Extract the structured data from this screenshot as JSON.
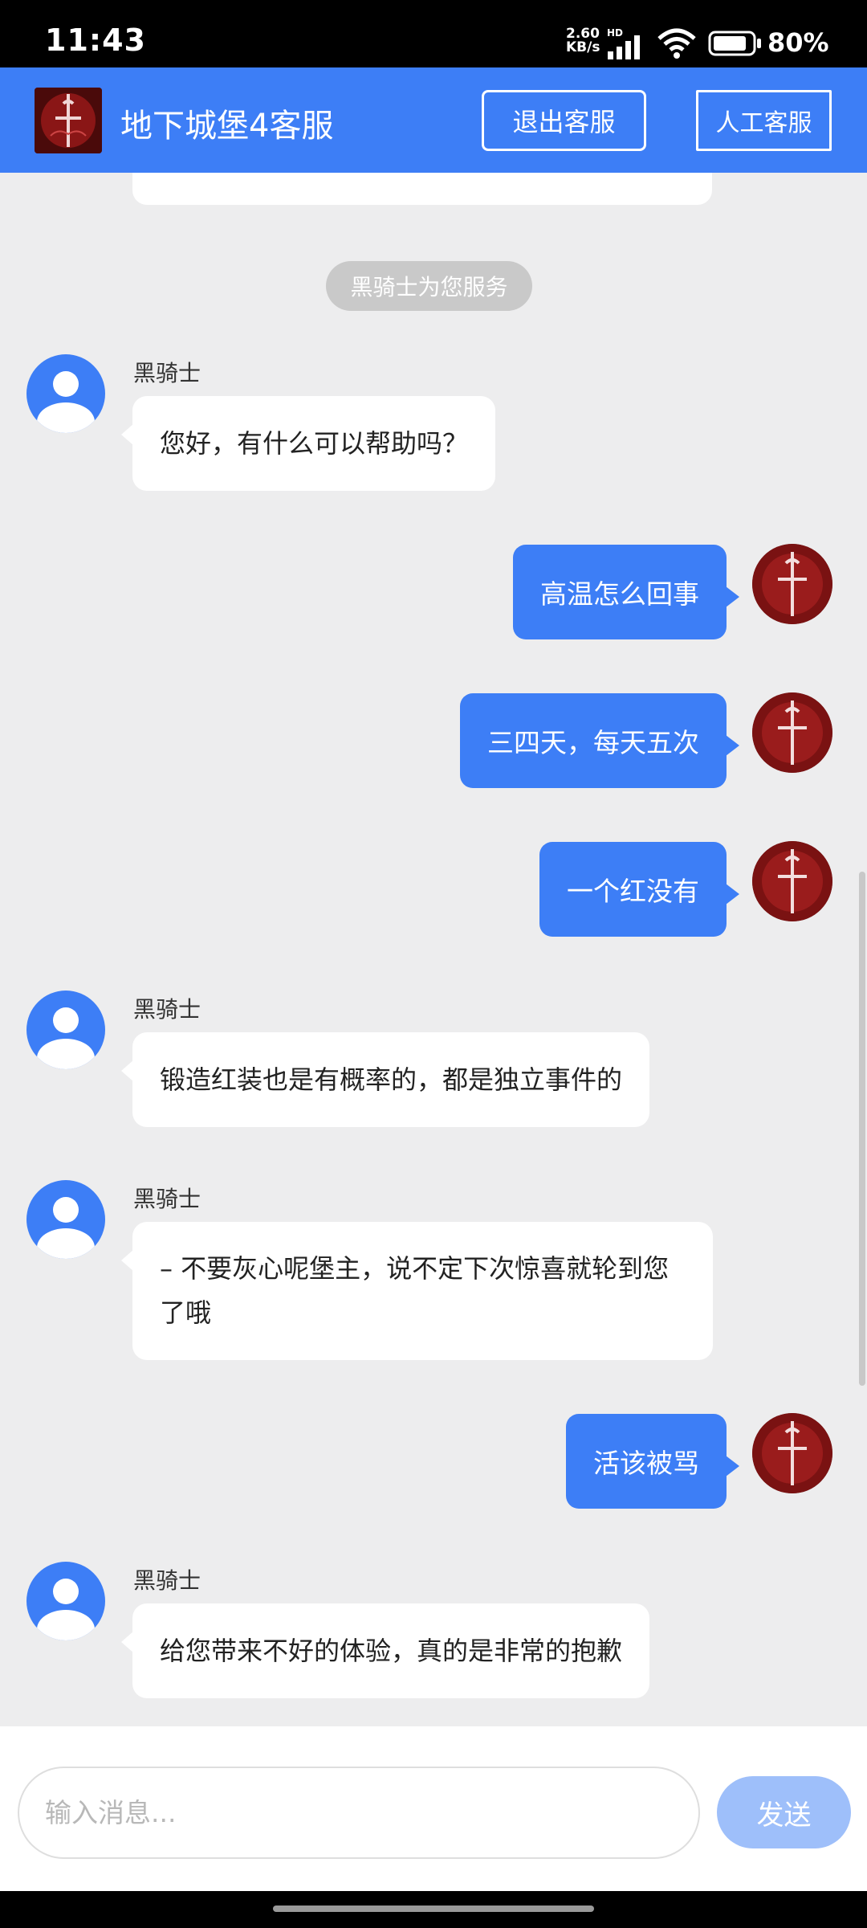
{
  "status_bar": {
    "time": "11:43",
    "net_speed_value": "2.60",
    "net_speed_unit": "KB/s",
    "hd": "HD",
    "battery": "80%",
    "icons": [
      "signal-icon",
      "wifi-icon",
      "battery-icon"
    ]
  },
  "header": {
    "title": "地下城堡4客服",
    "exit_label": "退出客服",
    "human_label": "人工客服",
    "bg_color": "#3d7ef6"
  },
  "system_notice": "黑骑士为您服务",
  "messages": [
    {
      "from": "agent",
      "sender": "黑骑士",
      "text": "您好，有什么可以帮助吗？"
    },
    {
      "from": "me",
      "text": "高温怎么回事"
    },
    {
      "from": "me",
      "text": "三四天，每天五次"
    },
    {
      "from": "me",
      "text": "一个红没有"
    },
    {
      "from": "agent",
      "sender": "黑骑士",
      "text": "锻造红装也是有概率的，都是独立事件的"
    },
    {
      "from": "agent",
      "sender": "黑骑士",
      "text": "– 不要灰心呢堡主，说不定下次惊喜就轮到您了哦"
    },
    {
      "from": "me",
      "text": "活该被骂"
    },
    {
      "from": "agent",
      "sender": "黑骑士",
      "text": "给您带来不好的体验，真的是非常的抱歉"
    }
  ],
  "input": {
    "placeholder": "输入消息...",
    "value": "",
    "send_label": "发送"
  }
}
